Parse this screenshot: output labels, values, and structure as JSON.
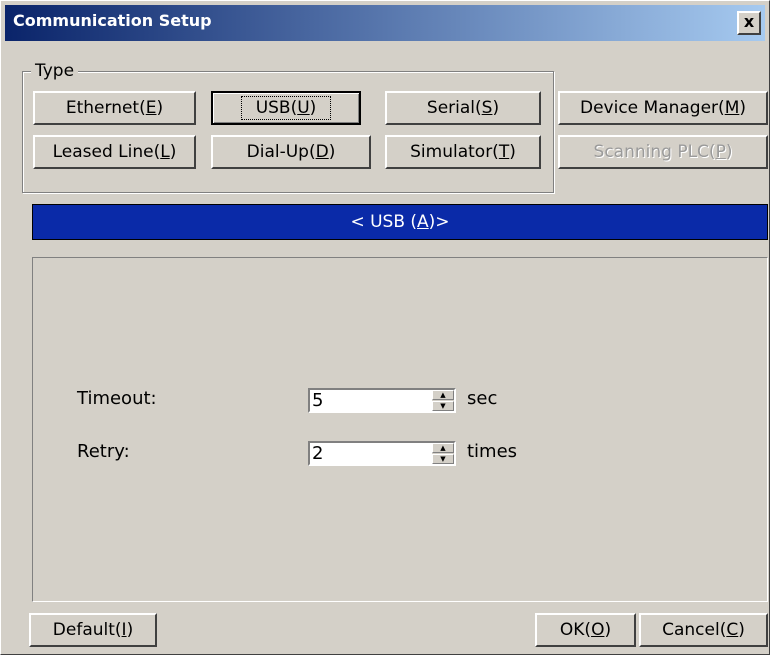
{
  "window": {
    "title": "Communication Setup",
    "close_label": "x"
  },
  "type_group": {
    "label": "Type",
    "buttons": {
      "ethernet": {
        "text": "Ethernet(",
        "key": "E",
        "end": ")"
      },
      "usb": {
        "text": "USB(",
        "key": "U",
        "end": ")"
      },
      "serial": {
        "text": "Serial(",
        "key": "S",
        "end": ")"
      },
      "leased": {
        "text": "Leased Line(",
        "key": "L",
        "end": ")"
      },
      "dialup": {
        "text": "Dial-Up(",
        "key": "D",
        "end": ")"
      },
      "simulator": {
        "text": "Simulator(",
        "key": "T",
        "end": ")"
      }
    }
  },
  "device_manager": {
    "text": "Device Manager(",
    "key": "M",
    "end": ")"
  },
  "scanning_plc": {
    "text": "Scanning PLC(",
    "key": "P",
    "end": ")"
  },
  "banner": {
    "text": "< USB (",
    "key": "A",
    "end": ")>"
  },
  "settings": {
    "timeout": {
      "label": "Timeout:",
      "value": "5",
      "unit": "sec"
    },
    "retry": {
      "label": "Retry:",
      "value": "2",
      "unit": "times"
    }
  },
  "footer": {
    "default": {
      "text": "Default(",
      "key": "I",
      "end": ")"
    },
    "ok": {
      "text": "OK(",
      "key": "O",
      "end": ")"
    },
    "cancel": {
      "text": "Cancel(",
      "key": "C",
      "end": ")"
    }
  },
  "colors": {
    "titlebar_start": "#0a246a",
    "titlebar_end": "#a6caf0",
    "banner": "#0a2aa8",
    "face": "#d4d0c8"
  }
}
